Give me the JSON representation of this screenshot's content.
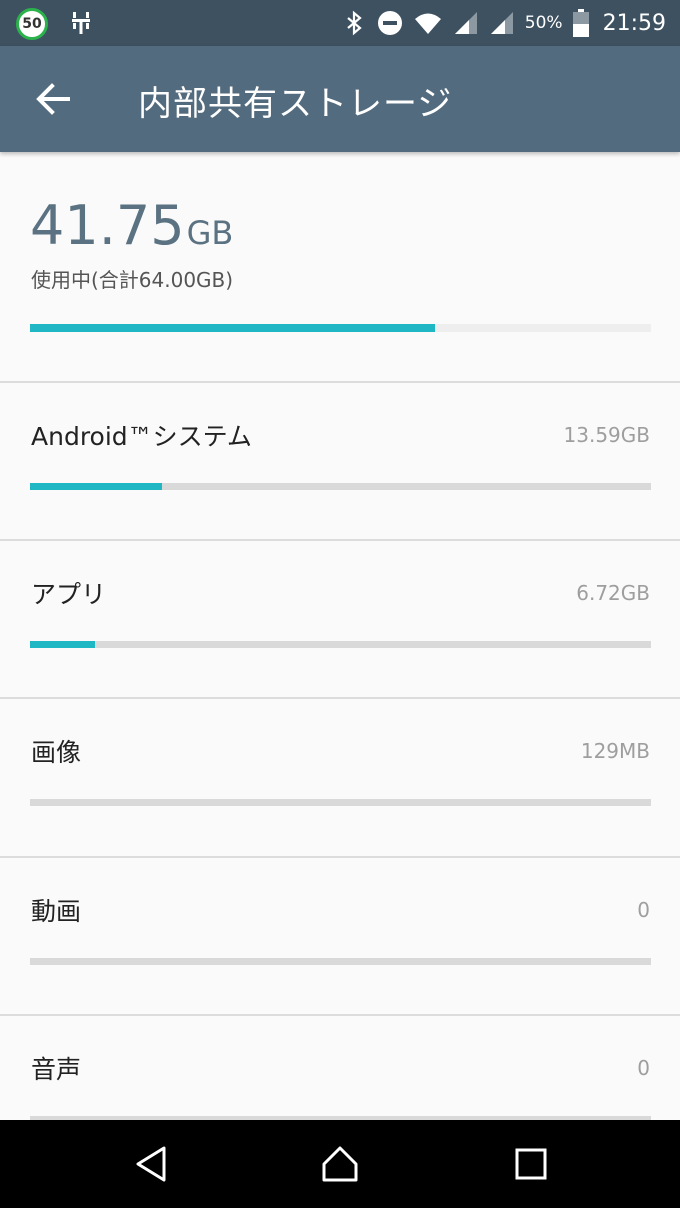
{
  "status_bar": {
    "badge": "50",
    "battery": "50%",
    "time": "21:59",
    "icons": [
      "usb-icon",
      "bluetooth-icon",
      "do-not-disturb-icon",
      "wifi-icon",
      "signal-icon",
      "battery-icon"
    ]
  },
  "app_bar": {
    "title": "内部共有ストレージ",
    "back_icon": "arrow-left-icon"
  },
  "summary": {
    "used_number": "41.75",
    "used_unit": "GB",
    "caption": "使用中(合計64.00GB)",
    "used_fraction": 0.652
  },
  "categories": [
    {
      "label": "Android™システム",
      "size": "13.59GB",
      "fraction": 0.212
    },
    {
      "label": "アプリ",
      "size": "6.72GB",
      "fraction": 0.105
    },
    {
      "label": "画像",
      "size": "129MB",
      "fraction": 0.0
    },
    {
      "label": "動画",
      "size": "0",
      "fraction": 0.0
    },
    {
      "label": "音声",
      "size": "0",
      "fraction": 0.0
    }
  ],
  "nav_bar": {
    "icons": [
      "back-triangle-icon",
      "home-icon",
      "recents-icon"
    ]
  },
  "colors": {
    "status_bar": "#3e5161",
    "app_bar": "#536b7e",
    "accent": "#1fb7c4",
    "background": "#fafafa"
  }
}
